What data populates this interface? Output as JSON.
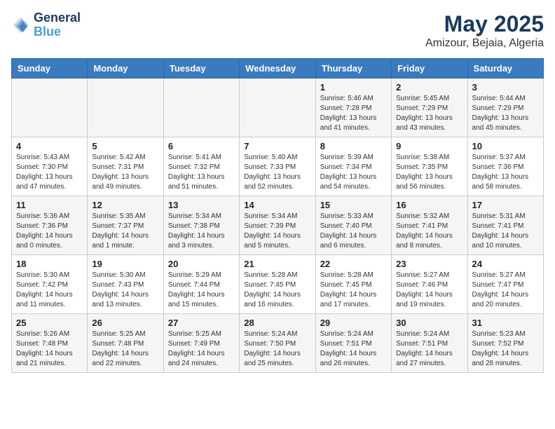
{
  "header": {
    "logo_line1": "General",
    "logo_line2": "Blue",
    "month": "May 2025",
    "location": "Amizour, Bejaia, Algeria"
  },
  "weekdays": [
    "Sunday",
    "Monday",
    "Tuesday",
    "Wednesday",
    "Thursday",
    "Friday",
    "Saturday"
  ],
  "weeks": [
    [
      {
        "day": "",
        "info": ""
      },
      {
        "day": "",
        "info": ""
      },
      {
        "day": "",
        "info": ""
      },
      {
        "day": "",
        "info": ""
      },
      {
        "day": "1",
        "info": "Sunrise: 5:46 AM\nSunset: 7:28 PM\nDaylight: 13 hours\nand 41 minutes."
      },
      {
        "day": "2",
        "info": "Sunrise: 5:45 AM\nSunset: 7:29 PM\nDaylight: 13 hours\nand 43 minutes."
      },
      {
        "day": "3",
        "info": "Sunrise: 5:44 AM\nSunset: 7:29 PM\nDaylight: 13 hours\nand 45 minutes."
      }
    ],
    [
      {
        "day": "4",
        "info": "Sunrise: 5:43 AM\nSunset: 7:30 PM\nDaylight: 13 hours\nand 47 minutes."
      },
      {
        "day": "5",
        "info": "Sunrise: 5:42 AM\nSunset: 7:31 PM\nDaylight: 13 hours\nand 49 minutes."
      },
      {
        "day": "6",
        "info": "Sunrise: 5:41 AM\nSunset: 7:32 PM\nDaylight: 13 hours\nand 51 minutes."
      },
      {
        "day": "7",
        "info": "Sunrise: 5:40 AM\nSunset: 7:33 PM\nDaylight: 13 hours\nand 52 minutes."
      },
      {
        "day": "8",
        "info": "Sunrise: 5:39 AM\nSunset: 7:34 PM\nDaylight: 13 hours\nand 54 minutes."
      },
      {
        "day": "9",
        "info": "Sunrise: 5:38 AM\nSunset: 7:35 PM\nDaylight: 13 hours\nand 56 minutes."
      },
      {
        "day": "10",
        "info": "Sunrise: 5:37 AM\nSunset: 7:36 PM\nDaylight: 13 hours\nand 58 minutes."
      }
    ],
    [
      {
        "day": "11",
        "info": "Sunrise: 5:36 AM\nSunset: 7:36 PM\nDaylight: 14 hours\nand 0 minutes."
      },
      {
        "day": "12",
        "info": "Sunrise: 5:35 AM\nSunset: 7:37 PM\nDaylight: 14 hours\nand 1 minute."
      },
      {
        "day": "13",
        "info": "Sunrise: 5:34 AM\nSunset: 7:38 PM\nDaylight: 14 hours\nand 3 minutes."
      },
      {
        "day": "14",
        "info": "Sunrise: 5:34 AM\nSunset: 7:39 PM\nDaylight: 14 hours\nand 5 minutes."
      },
      {
        "day": "15",
        "info": "Sunrise: 5:33 AM\nSunset: 7:40 PM\nDaylight: 14 hours\nand 6 minutes."
      },
      {
        "day": "16",
        "info": "Sunrise: 5:32 AM\nSunset: 7:41 PM\nDaylight: 14 hours\nand 8 minutes."
      },
      {
        "day": "17",
        "info": "Sunrise: 5:31 AM\nSunset: 7:41 PM\nDaylight: 14 hours\nand 10 minutes."
      }
    ],
    [
      {
        "day": "18",
        "info": "Sunrise: 5:30 AM\nSunset: 7:42 PM\nDaylight: 14 hours\nand 11 minutes."
      },
      {
        "day": "19",
        "info": "Sunrise: 5:30 AM\nSunset: 7:43 PM\nDaylight: 14 hours\nand 13 minutes."
      },
      {
        "day": "20",
        "info": "Sunrise: 5:29 AM\nSunset: 7:44 PM\nDaylight: 14 hours\nand 15 minutes."
      },
      {
        "day": "21",
        "info": "Sunrise: 5:28 AM\nSunset: 7:45 PM\nDaylight: 14 hours\nand 16 minutes."
      },
      {
        "day": "22",
        "info": "Sunrise: 5:28 AM\nSunset: 7:45 PM\nDaylight: 14 hours\nand 17 minutes."
      },
      {
        "day": "23",
        "info": "Sunrise: 5:27 AM\nSunset: 7:46 PM\nDaylight: 14 hours\nand 19 minutes."
      },
      {
        "day": "24",
        "info": "Sunrise: 5:27 AM\nSunset: 7:47 PM\nDaylight: 14 hours\nand 20 minutes."
      }
    ],
    [
      {
        "day": "25",
        "info": "Sunrise: 5:26 AM\nSunset: 7:48 PM\nDaylight: 14 hours\nand 21 minutes."
      },
      {
        "day": "26",
        "info": "Sunrise: 5:25 AM\nSunset: 7:48 PM\nDaylight: 14 hours\nand 22 minutes."
      },
      {
        "day": "27",
        "info": "Sunrise: 5:25 AM\nSunset: 7:49 PM\nDaylight: 14 hours\nand 24 minutes."
      },
      {
        "day": "28",
        "info": "Sunrise: 5:24 AM\nSunset: 7:50 PM\nDaylight: 14 hours\nand 25 minutes."
      },
      {
        "day": "29",
        "info": "Sunrise: 5:24 AM\nSunset: 7:51 PM\nDaylight: 14 hours\nand 26 minutes."
      },
      {
        "day": "30",
        "info": "Sunrise: 5:24 AM\nSunset: 7:51 PM\nDaylight: 14 hours\nand 27 minutes."
      },
      {
        "day": "31",
        "info": "Sunrise: 5:23 AM\nSunset: 7:52 PM\nDaylight: 14 hours\nand 28 minutes."
      }
    ]
  ]
}
